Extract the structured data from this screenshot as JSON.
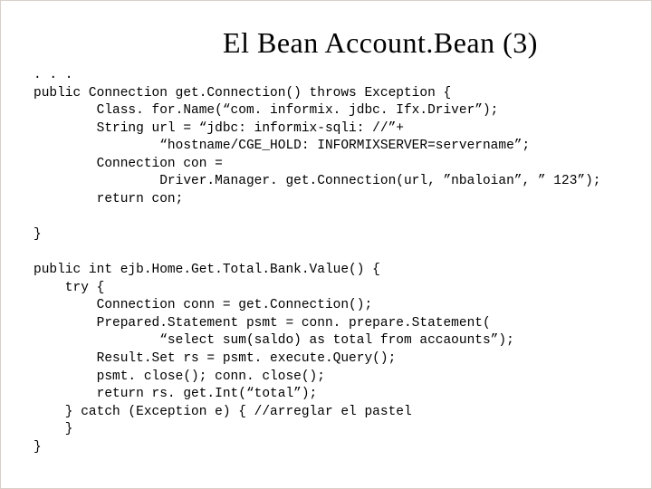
{
  "title": "El Bean Account.Bean (3)",
  "code": {
    "l01": ". . .",
    "l02": "public Connection get.Connection() throws Exception {",
    "l03": "        Class. for.Name(“com. informix. jdbc. Ifx.Driver”);",
    "l04": "        String url = “jdbc: informix-sqli: //”+",
    "l05": "                “hostname/CGE_HOLD: INFORMIXSERVER=servername”;",
    "l06": "        Connection con =",
    "l07": "                Driver.Manager. get.Connection(url, ”nbaloian”, ” 123”);",
    "l08": "        return con;",
    "l09": "",
    "l10": "}",
    "l11": "",
    "l12": "public int ejb.Home.Get.Total.Bank.Value() {",
    "l13": "    try {",
    "l14": "        Connection conn = get.Connection();",
    "l15": "        Prepared.Statement psmt = conn. prepare.Statement(",
    "l16": "                “select sum(saldo) as total from accaounts”);",
    "l17": "        Result.Set rs = psmt. execute.Query();",
    "l18": "        psmt. close(); conn. close();",
    "l19": "        return rs. get.Int(“total”);",
    "l20": "    } catch (Exception e) { //arreglar el pastel",
    "l21": "    }",
    "l22": "}"
  }
}
